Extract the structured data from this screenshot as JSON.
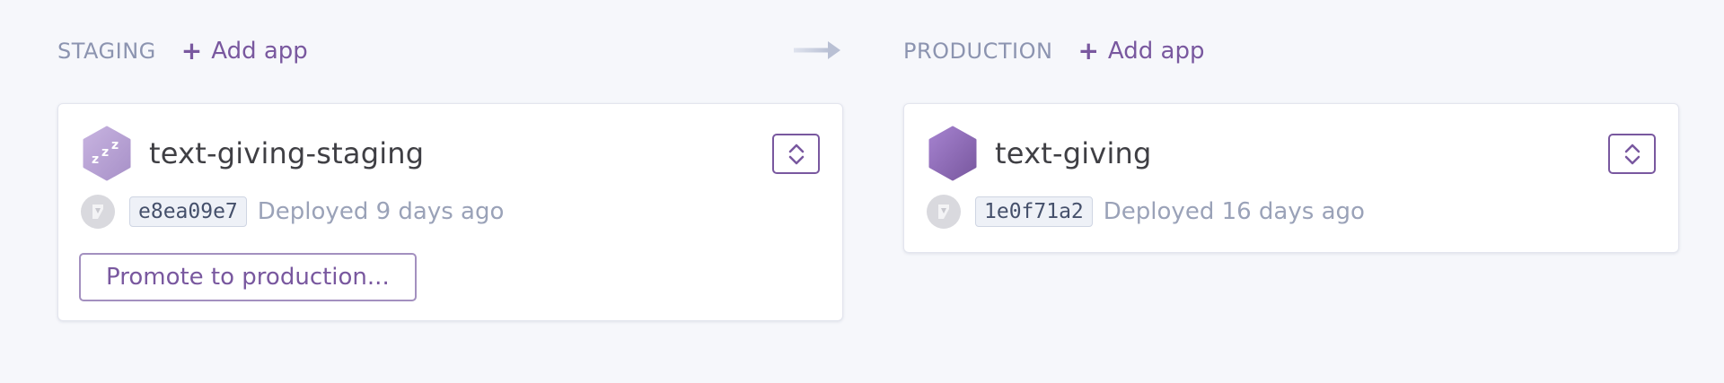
{
  "pipeline": {
    "staging": {
      "title": "STAGING",
      "add_app_label": "Add app",
      "app": {
        "name": "text-giving-staging",
        "state": "sleeping",
        "commit": "e8ea09e7",
        "deployed_text": "Deployed 9 days ago",
        "promote_label": "Promote to production..."
      }
    },
    "production": {
      "title": "PRODUCTION",
      "add_app_label": "Add app",
      "app": {
        "name": "text-giving",
        "state": "awake",
        "commit": "1e0f71a2",
        "deployed_text": "Deployed 16 days ago"
      }
    }
  },
  "colors": {
    "accent": "#79589f",
    "muted": "#9aa2b8",
    "background": "#f6f7fb"
  },
  "icons": {
    "add": "plus-icon",
    "arrow": "arrow-right-icon",
    "switcher": "chevron-up-down-icon",
    "avatar": "user-avatar-icon",
    "app_sleeping": "zzz-hexagon-icon",
    "app_awake": "hexagon-icon"
  }
}
